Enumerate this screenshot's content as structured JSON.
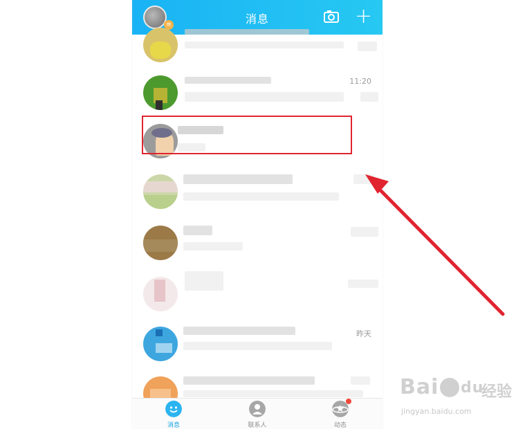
{
  "header": {
    "title": "消息",
    "badge": "≡",
    "plus": "+"
  },
  "conversations": [
    {
      "time": ""
    },
    {
      "time": "11:20"
    },
    {
      "time": ""
    },
    {
      "time": ""
    },
    {
      "time": ""
    },
    {
      "time": ""
    },
    {
      "time": "昨天"
    },
    {
      "time": ""
    }
  ],
  "tabs": [
    {
      "label": "消息",
      "icon": "chat-bubble-icon"
    },
    {
      "label": "联系人",
      "icon": "person-icon"
    },
    {
      "label": "动态",
      "icon": "star-planet-icon"
    }
  ],
  "watermark": {
    "logo": "Bai",
    "logo_tail": "du",
    "cn": "经验",
    "url": "jingyan.baidu.com"
  },
  "colors": {
    "header": "#19b3f5",
    "highlight": "#e02430",
    "arrow": "#e02430",
    "active_tab": "#16a4e6"
  }
}
